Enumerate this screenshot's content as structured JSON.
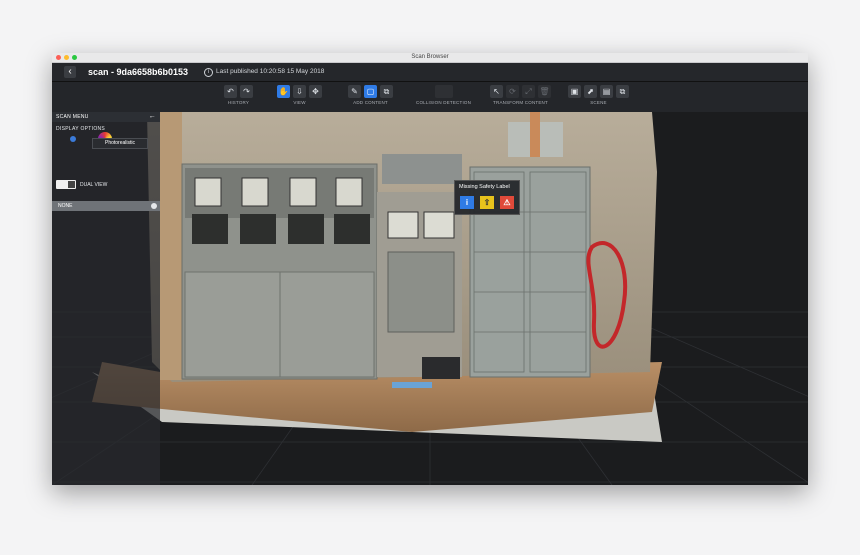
{
  "window": {
    "title": "Scan Browser"
  },
  "header": {
    "back_glyph": "‹",
    "scan_title": "scan - 9da6658b6b0153",
    "info_glyph": "i",
    "published": "Last published 10:20:58 15 May 2018"
  },
  "toolbar": {
    "history": {
      "label": "HISTORY",
      "icons": [
        "undo-icon",
        "redo-icon"
      ],
      "glyphs": [
        "↶",
        "↷"
      ]
    },
    "view": {
      "label": "VIEW",
      "icons": [
        "hand-icon",
        "walk-icon",
        "move-icon"
      ],
      "glyphs": [
        "✋",
        "⇩",
        "✥"
      ],
      "active_index": 0
    },
    "add_content": {
      "label": "ADD CONTENT",
      "icons": [
        "pencil-icon",
        "tag-icon",
        "attach-icon"
      ],
      "glyphs": [
        "✎",
        "▢",
        "⧉"
      ],
      "active_index": 1
    },
    "collision": {
      "label": "COLLISION DETECTION"
    },
    "transform": {
      "label": "TRANSFORM CONTENT",
      "icons": [
        "select-icon",
        "rotate-icon",
        "scale-icon",
        "delete-icon"
      ],
      "glyphs": [
        "↖",
        "⟳",
        "⤢",
        "🗑"
      ]
    },
    "scene": {
      "label": "SCENE",
      "icons": [
        "save-icon",
        "export-icon",
        "image-icon",
        "copy-icon"
      ],
      "glyphs": [
        "▣",
        "⬈",
        "▤",
        "⧉"
      ]
    }
  },
  "side_panel": {
    "title": "SCAN MENU",
    "collapse_glyph": "←",
    "display_options": "DISPLAY OPTIONS",
    "render_mode": "Photorealistic",
    "dual_view": "DUAL VIEW",
    "layer": "NONE"
  },
  "tag": {
    "text": "Missing Safety Label",
    "icons": [
      "info-icon",
      "exit-sign-icon",
      "warning-icon"
    ],
    "glyphs": [
      "i",
      "⇧",
      "⚠"
    ]
  },
  "colors": {
    "accent": "#2f7be6",
    "warning": "#e04a3a",
    "caution": "#e8c31c"
  }
}
